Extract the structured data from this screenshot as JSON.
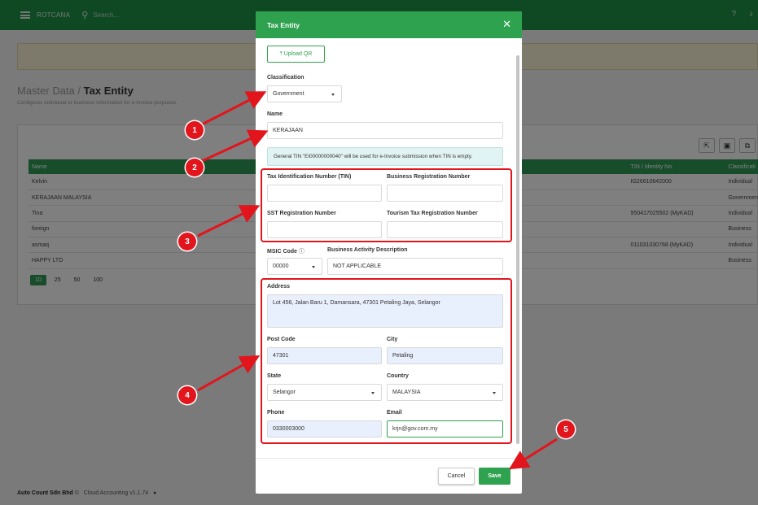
{
  "topbar": {
    "brand": "ROTCANA",
    "search_placeholder": "Search..."
  },
  "page": {
    "crumb_root": "Master Data / ",
    "crumb_current": "Tax Entity",
    "subtitle": "Configures individual or business information for e-invoice purposes."
  },
  "table": {
    "headers": {
      "name": "Name",
      "tin": "TIN / Identity No.",
      "classification": "Classificati"
    },
    "rows": [
      {
        "name": "Kelvin",
        "tin": "IG26610642000",
        "classification": "Individual"
      },
      {
        "name": "KERAJAAN MALAYSIA",
        "tin": "",
        "classification": "Governmen"
      },
      {
        "name": "Tina",
        "tin": "950417025502 (MyKAD)",
        "classification": "Individual"
      },
      {
        "name": "foreign",
        "tin": "",
        "classification": "Business"
      },
      {
        "name": "asmaq",
        "tin": "011031030768 (MyKAD)",
        "classification": "Individual"
      },
      {
        "name": "HAPPY LTD",
        "tin": "",
        "classification": "Business"
      }
    ],
    "page_sizes": [
      "10",
      "25",
      "50",
      "100"
    ]
  },
  "footer": {
    "company": "Auto Count Sdn Bhd",
    "copyright": "©",
    "product": "Cloud Accounting v1.1.74"
  },
  "modal": {
    "title": "Tax Entity",
    "upload_label": "Upload QR",
    "classification_label": "Classification",
    "classification_value": "Government",
    "name_label": "Name",
    "name_value": "KERAJAAN",
    "info_text": "General TIN \"EI00000000040\" will be used for e-Invoice submission when TIN is empty.",
    "tin_label": "Tax Identification Number (TIN)",
    "brn_label": "Business Registration Number",
    "sst_label": "SST Registration Number",
    "tourism_label": "Tourism Tax Registration Number",
    "msic_label": "MSIC Code",
    "msic_value": "00000",
    "bad_label": "Business Activity Description",
    "bad_value": "NOT APPLICABLE",
    "address_label": "Address",
    "address_value": "Lot 456, Jalan Baru 1, Damansara, 47301 Petaling Jaya, Selangor",
    "postcode_label": "Post Code",
    "postcode_value": "47301",
    "city_label": "City",
    "city_value": "Petaling",
    "state_label": "State",
    "state_value": "Selangor",
    "country_label": "Country",
    "country_value": "MALAYSIA",
    "phone_label": "Phone",
    "phone_value": "0330003000",
    "email_label": "Email",
    "email_value": "krjn@gov.com.my",
    "cancel_label": "Cancel",
    "save_label": "Save"
  },
  "annotations": [
    "1",
    "2",
    "3",
    "4",
    "5"
  ],
  "colors": {
    "primary": "#2fa24f",
    "annotation": "#e2141c"
  }
}
